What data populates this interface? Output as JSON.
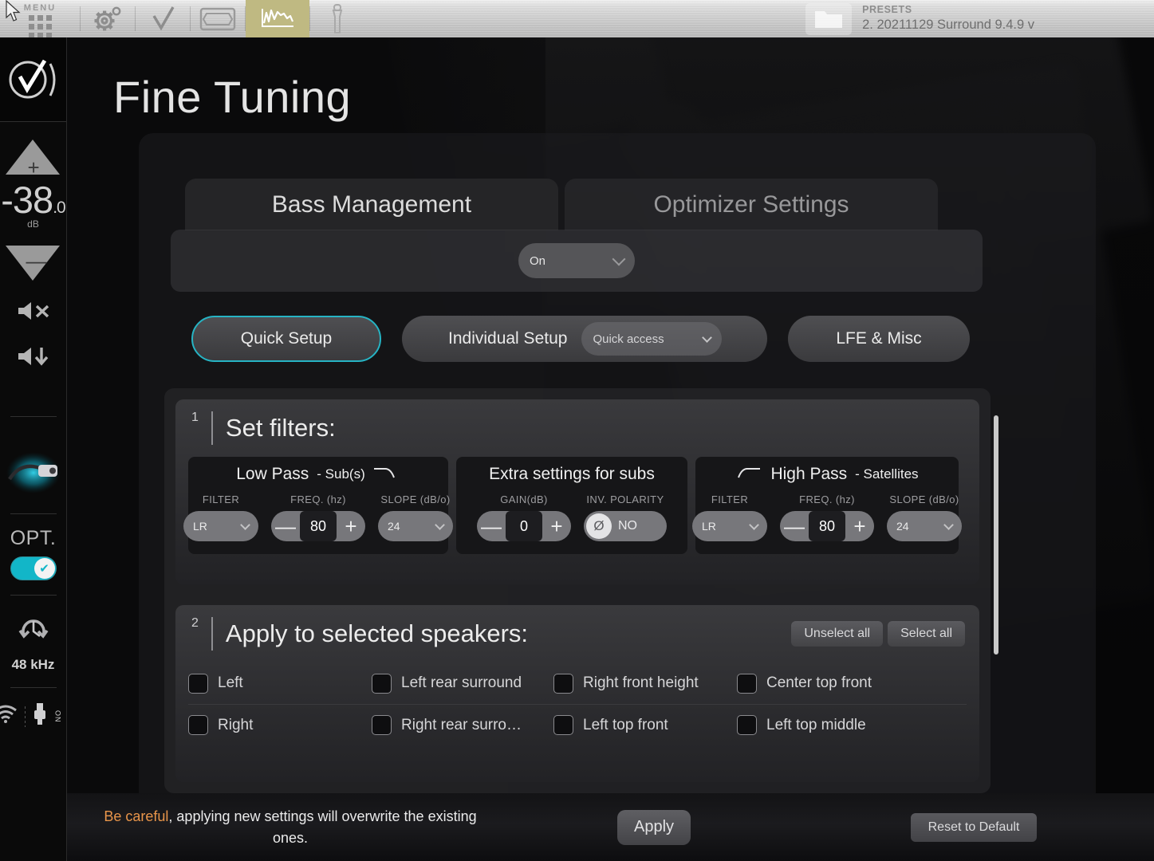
{
  "topbar": {
    "menu_label": "MENU",
    "icons": [
      "grid-menu-icon",
      "gear-icon",
      "checkmark-icon",
      "screen-icon",
      "graph-icon",
      "microphone-icon"
    ],
    "presets": {
      "title": "PRESETS",
      "value": "2. 20211129 Surround 9.4.9 v"
    }
  },
  "sidebar": {
    "volume": {
      "int": "-38",
      "dec": ".0",
      "unit": "dB"
    },
    "opt_label": "OPT.",
    "opt_enabled": true,
    "sample_rate": "48 kHz",
    "connection_state": "ON",
    "accent": "#12b6c8"
  },
  "page": {
    "title": "Fine Tuning"
  },
  "tabs": [
    {
      "label": "Bass Management",
      "selected": true
    },
    {
      "label": "Optimizer Settings",
      "selected": false
    }
  ],
  "bass_management": {
    "enable_select": {
      "value": "On"
    },
    "modes": {
      "quick_setup": "Quick Setup",
      "individual_setup": "Individual Setup",
      "quick_access_select": "Quick access",
      "lfe_misc": "LFE & Misc",
      "selected": "quick_setup",
      "selected_color": "#26b4c4"
    },
    "section1": {
      "number": "1",
      "title": "Set filters:",
      "panels": [
        {
          "title": "Low Pass",
          "subtitle": "- Sub(s)",
          "icon": "lowpass-curve-icon",
          "fields": [
            {
              "label": "FILTER",
              "type": "select",
              "value": "LR"
            },
            {
              "label": "FREQ. (hz)",
              "type": "stepper",
              "value": "80",
              "minus": "—",
              "plus": "+"
            },
            {
              "label": "SLOPE (dB/o)",
              "type": "select",
              "value": "24"
            }
          ]
        },
        {
          "title": "Extra settings for subs",
          "subtitle": "",
          "icon": "",
          "fields": [
            {
              "label": "GAIN(dB)",
              "type": "stepper",
              "value": "0",
              "minus": "—",
              "plus": "+"
            },
            {
              "label": "INV. POLARITY",
              "type": "polarity",
              "value": "NO",
              "glyph": "Ø"
            }
          ]
        },
        {
          "title": "High Pass",
          "subtitle": "- Satellites",
          "icon": "highpass-curve-icon",
          "fields": [
            {
              "label": "FILTER",
              "type": "select",
              "value": "LR"
            },
            {
              "label": "FREQ. (hz)",
              "type": "stepper",
              "value": "80",
              "minus": "—",
              "plus": "+"
            },
            {
              "label": "SLOPE (dB/o)",
              "type": "select",
              "value": "24"
            }
          ]
        }
      ]
    },
    "section2": {
      "number": "2",
      "title": "Apply to selected speakers:",
      "unselect_all": "Unselect all",
      "select_all": "Select all",
      "rows": [
        [
          {
            "label": "Left",
            "checked": false
          },
          {
            "label": "Left rear surround",
            "checked": false
          },
          {
            "label": "Right front height",
            "checked": false
          },
          {
            "label": "Center top front",
            "checked": false
          }
        ],
        [
          {
            "label": "Right",
            "checked": false
          },
          {
            "label": "Right rear surro…",
            "checked": false
          },
          {
            "label": "Left top front",
            "checked": false
          },
          {
            "label": "Left top middle",
            "checked": false
          }
        ]
      ]
    }
  },
  "bottombar": {
    "warning_bold": "Be careful",
    "warning_rest": ", applying new settings will overwrite the existing ones.",
    "apply": "Apply",
    "reset": "Reset to Default",
    "warning_color": "#e8954a"
  }
}
